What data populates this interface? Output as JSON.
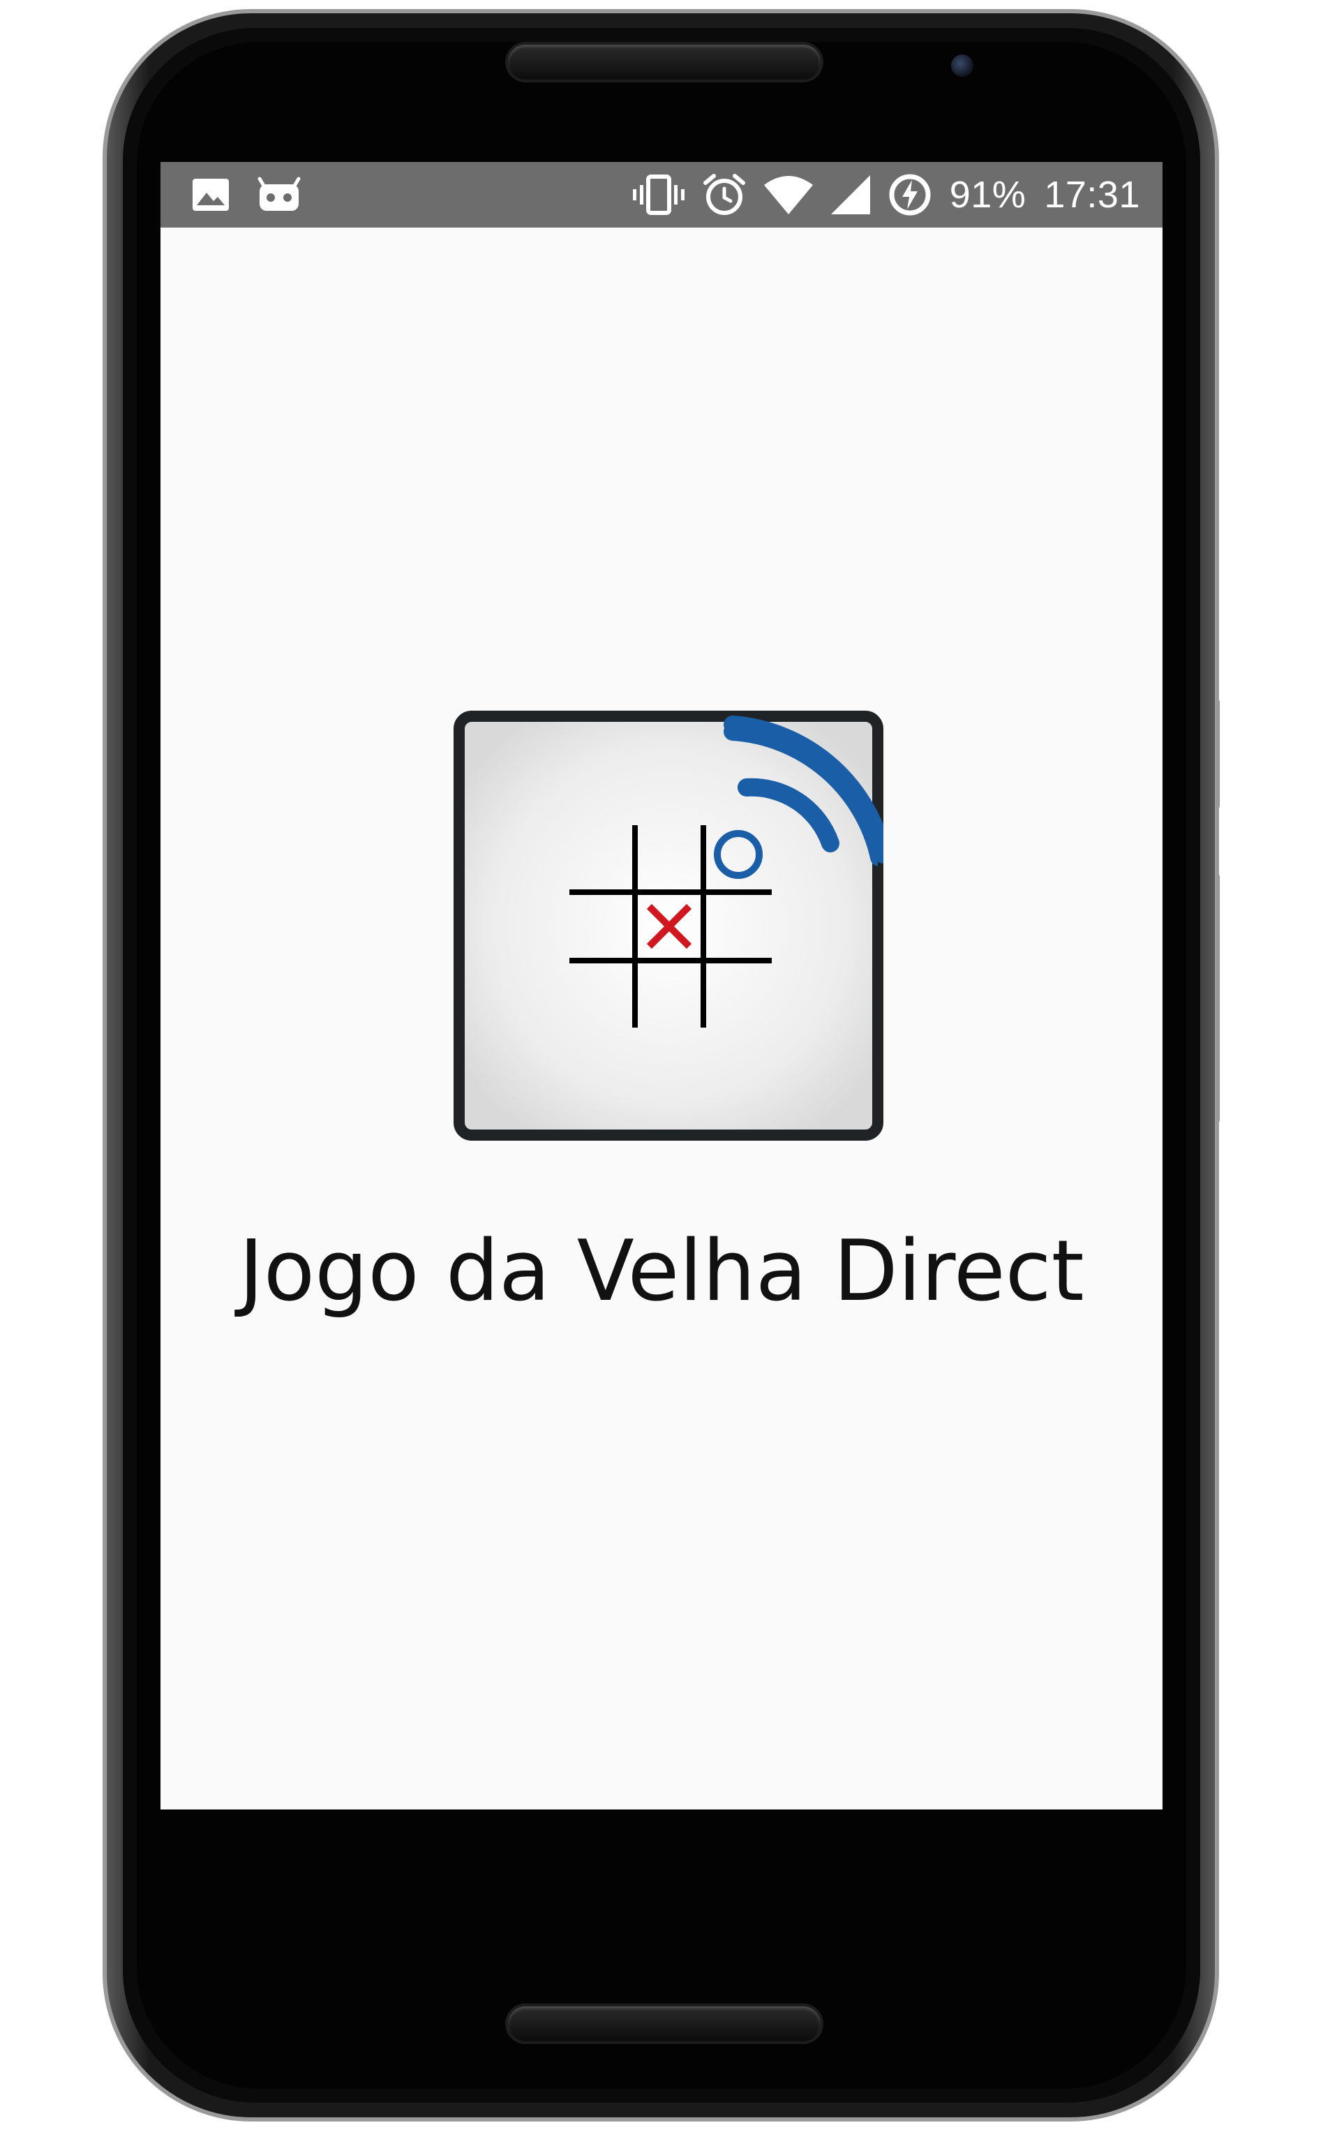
{
  "status_bar": {
    "icons_left": [
      "image-icon",
      "android-debug-icon"
    ],
    "icons_right": [
      "vibrate-icon",
      "alarm-icon",
      "wifi-icon",
      "signal-icon",
      "battery-charging-icon"
    ],
    "battery": "91%",
    "time": "17:31",
    "background_color": "#6d6d6d"
  },
  "app": {
    "title": "Jogo da Velha Direct",
    "icon_name": "tic-tac-toe-wifi-logo",
    "x_color": "#d0161f",
    "o_color": "#1a5ea8"
  },
  "navigation": {
    "back": "back-icon",
    "home": "home-icon",
    "recents": "recents-icon"
  }
}
